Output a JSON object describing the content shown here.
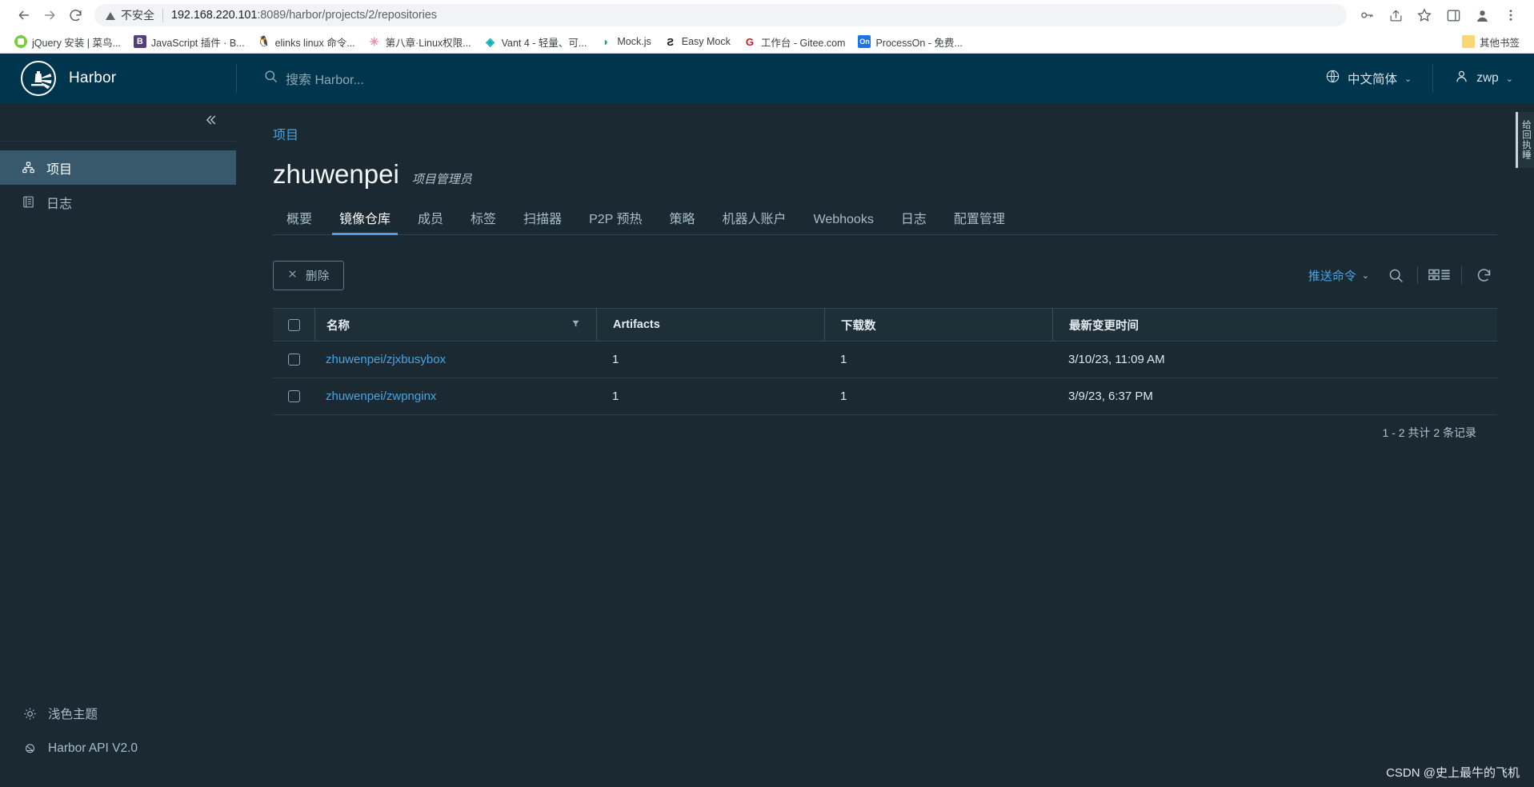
{
  "browser": {
    "nav": {
      "back_icon": "arrow-left-icon",
      "forward_icon": "arrow-right-icon",
      "reload_icon": "reload-icon",
      "insecure_label": "不安全",
      "url_host": "192.168.220.101",
      "url_rest": ":8089/harbor/projects/2/repositories",
      "url_full": "192.168.220.101:8089/harbor/projects/2/repositories",
      "password_icon": "key-icon",
      "share_icon": "share-icon",
      "bookmark_icon": "star-icon",
      "sidepanel_icon": "side-panel-icon",
      "profile_icon": "profile-icon",
      "menu_icon": "three-dots-menu-icon"
    },
    "bookmarks": [
      {
        "label": "jQuery 安装 | 菜鸟...",
        "favicon": "jquery-icon",
        "glyph": ""
      },
      {
        "label": "JavaScript 插件 · B...",
        "favicon": "bootstrap-icon",
        "glyph": "B"
      },
      {
        "label": "elinks linux 命令...",
        "favicon": "linux-tux-icon",
        "glyph": "🐧"
      },
      {
        "label": "第八章·Linux权限...",
        "favicon": "flower-icon",
        "glyph": "✳"
      },
      {
        "label": "Vant 4 - 轻量、可...",
        "favicon": "vant-icon",
        "glyph": "◈"
      },
      {
        "label": "Mock.js",
        "favicon": "mockjs-icon",
        "glyph": "◗"
      },
      {
        "label": "Easy Mock",
        "favicon": "easymock-icon",
        "glyph": "Ƨ"
      },
      {
        "label": "工作台 - Gitee.com",
        "favicon": "gitee-icon",
        "glyph": "G"
      },
      {
        "label": "ProcessOn - 免费...",
        "favicon": "processon-icon",
        "glyph": "On"
      }
    ],
    "other_bookmarks": {
      "label": "其他书签",
      "favicon": "folder-icon"
    }
  },
  "harbor": {
    "brand": {
      "name": "Harbor",
      "logo_icon": "harbor-logo-icon"
    },
    "search": {
      "placeholder": "搜索 Harbor...",
      "icon": "search-icon",
      "value": ""
    },
    "language": {
      "label": "中文简体",
      "icon": "globe-icon",
      "caret": "⌄"
    },
    "user": {
      "label": "zwp",
      "icon": "user-icon",
      "caret": "⌄"
    },
    "sidebar": {
      "collapse_icon": "chevron-double-left-icon",
      "items": [
        {
          "label": "项目",
          "icon": "projects-icon",
          "active": true
        },
        {
          "label": "日志",
          "icon": "logs-icon",
          "active": false
        }
      ],
      "footer": [
        {
          "label": "浅色主题",
          "icon": "sun-icon"
        },
        {
          "label": "Harbor API V2.0",
          "icon": "api-globe-icon"
        }
      ]
    },
    "breadcrumb": "项目",
    "project": {
      "name": "zhuwenpei",
      "role": "项目管理员"
    },
    "tabs": [
      {
        "label": "概要",
        "active": false
      },
      {
        "label": "镜像仓库",
        "active": true
      },
      {
        "label": "成员",
        "active": false
      },
      {
        "label": "标签",
        "active": false
      },
      {
        "label": "扫描器",
        "active": false
      },
      {
        "label": "P2P 预热",
        "active": false
      },
      {
        "label": "策略",
        "active": false
      },
      {
        "label": "机器人账户",
        "active": false
      },
      {
        "label": "Webhooks",
        "active": false
      },
      {
        "label": "日志",
        "active": false
      },
      {
        "label": "配置管理",
        "active": false
      }
    ],
    "toolbar": {
      "delete_label": "删除",
      "delete_icon": "close-x-icon",
      "push_command_label": "推送命令",
      "push_command_caret": "⌄",
      "search_icon": "search-icon",
      "view_toggle_icon": "card-list-view-icon",
      "refresh_icon": "refresh-icon"
    },
    "table": {
      "columns": [
        "名称",
        "Artifacts",
        "下载数",
        "最新变更时间"
      ],
      "filter_icon": "filter-icon",
      "select_all_checkbox": "checkbox-unchecked",
      "rows": [
        {
          "name": "zhuwenpei/zjxbusybox",
          "artifacts": "1",
          "downloads": "1",
          "modified": "3/10/23, 11:09 AM"
        },
        {
          "name": "zhuwenpei/zwpnginx",
          "artifacts": "1",
          "downloads": "1",
          "modified": "3/9/23, 6:37 PM"
        }
      ],
      "pagination": "1 - 2 共计 2 条记录"
    },
    "feedback_tab": "给回执睡",
    "colors": {
      "header_bg": "#00364d",
      "app_bg": "#1b2a32",
      "accent": "#4aa3df",
      "active_nav": "#38596b"
    }
  },
  "watermark": "CSDN @史上最牛的飞机"
}
